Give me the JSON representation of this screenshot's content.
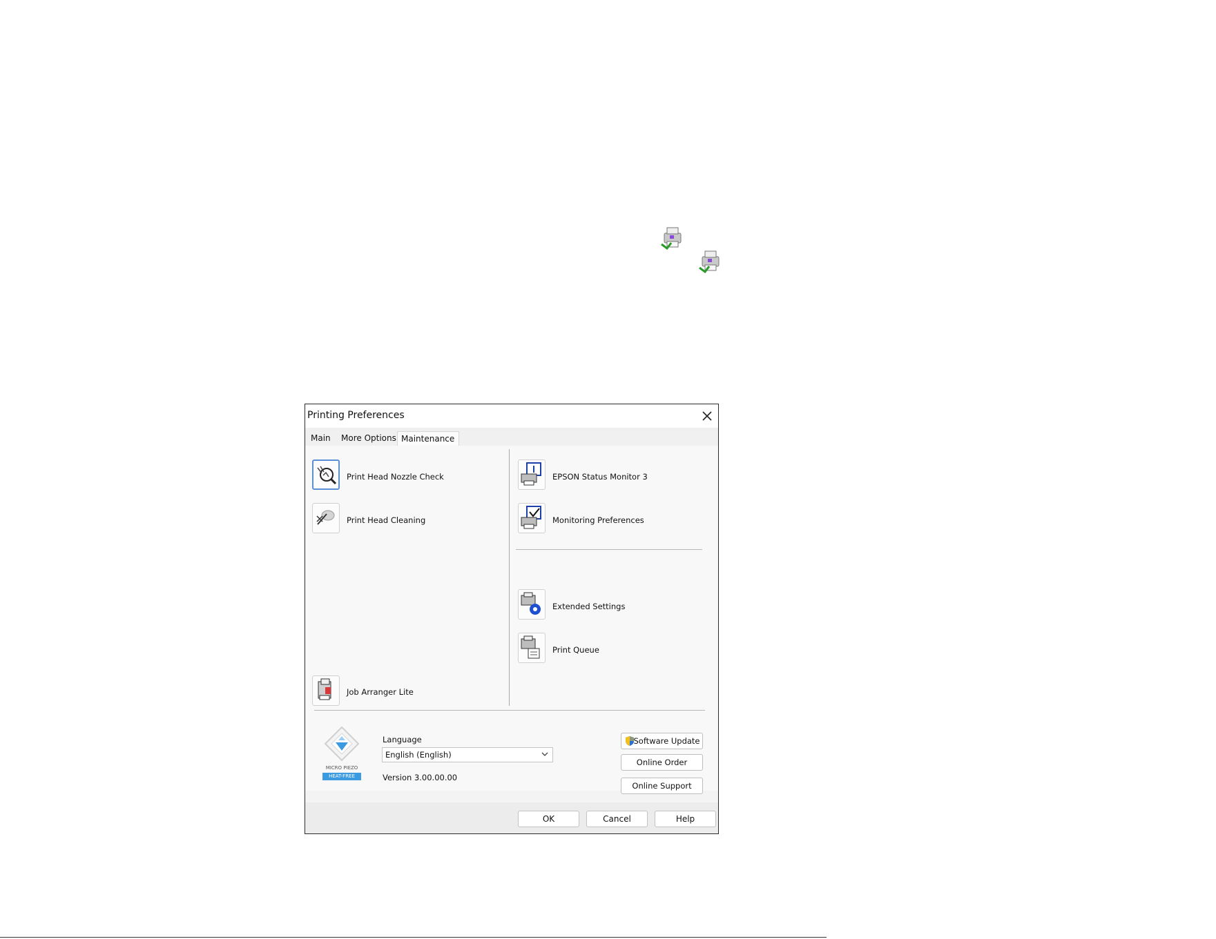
{
  "dialog": {
    "title": "Printing Preferences",
    "tabs": [
      {
        "label": "Main",
        "active": false
      },
      {
        "label": "More Options",
        "active": false
      },
      {
        "label": "Maintenance",
        "active": true
      }
    ],
    "left_tools": [
      {
        "label": "Print Head Nozzle Check",
        "icon": "nozzle-check-icon"
      },
      {
        "label": "Print Head Cleaning",
        "icon": "head-cleaning-icon"
      },
      {
        "label": "Job Arranger Lite",
        "icon": "job-arranger-icon"
      }
    ],
    "right_tools": [
      {
        "label": "EPSON Status Monitor 3",
        "icon": "status-monitor-icon"
      },
      {
        "label": "Monitoring Preferences",
        "icon": "monitoring-preferences-icon"
      },
      {
        "label": "Extended Settings",
        "icon": "extended-settings-icon"
      },
      {
        "label": "Print Queue",
        "icon": "print-queue-icon"
      }
    ],
    "logo": {
      "line1": "MICRO PIEZO",
      "line2": "HEAT-FREE"
    },
    "language": {
      "label": "Language",
      "value": "English (English)"
    },
    "version": "Version 3.00.00.00",
    "side_buttons": {
      "software_update": "Software Update",
      "online_order": "Online Order",
      "online_support": "Online Support"
    },
    "footer_buttons": {
      "ok": "OK",
      "cancel": "Cancel",
      "help": "Help"
    }
  },
  "colors": {
    "accent": "#5a8fd8",
    "logo_blue": "#3c9be0",
    "dialog_bg": "#f3f3f3"
  }
}
